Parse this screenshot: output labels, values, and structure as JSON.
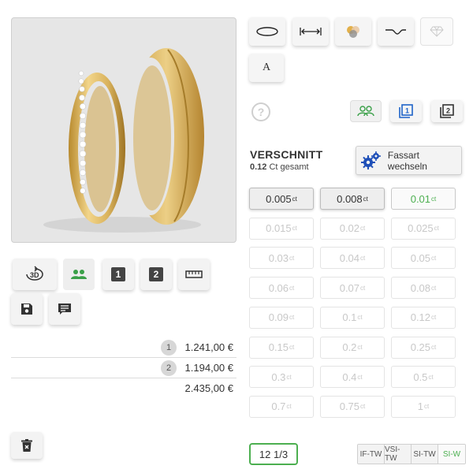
{
  "preview": {
    "image": "wedding-rings-image"
  },
  "toolbar": {
    "buttons": [
      {
        "name": "view-3d-button",
        "label": "3D"
      },
      {
        "name": "pair-view-button",
        "icon": "users-icon"
      },
      {
        "name": "ring-1-button",
        "label": "1"
      },
      {
        "name": "ring-2-button",
        "label": "2"
      },
      {
        "name": "measure-button",
        "icon": "ruler-icon"
      },
      {
        "name": "save-button",
        "icon": "floppy-disk-icon"
      },
      {
        "name": "comment-button",
        "icon": "comment-icon"
      }
    ]
  },
  "prices": [
    {
      "num": "1",
      "value": "1.241,00 €"
    },
    {
      "num": "2",
      "value": "1.194,00 €"
    },
    {
      "num": "",
      "value": "2.435,00 €"
    }
  ],
  "shapes": {
    "letter_label": "A"
  },
  "views": {
    "active": "pair",
    "one": "1",
    "two": "2"
  },
  "section": {
    "title": "VERSCHNITT",
    "total_value": "0.12",
    "total_suffix": "Ct gesamt",
    "fassart_label": "Fassart wechseln"
  },
  "carats": [
    {
      "value": "0.005",
      "state": "enabled"
    },
    {
      "value": "0.008",
      "state": "enabled"
    },
    {
      "value": "0.01",
      "state": "selected"
    },
    {
      "value": "0.015",
      "state": "disabled"
    },
    {
      "value": "0.02",
      "state": "disabled"
    },
    {
      "value": "0.025",
      "state": "disabled"
    },
    {
      "value": "0.03",
      "state": "disabled"
    },
    {
      "value": "0.04",
      "state": "disabled"
    },
    {
      "value": "0.05",
      "state": "disabled"
    },
    {
      "value": "0.06",
      "state": "disabled"
    },
    {
      "value": "0.07",
      "state": "disabled"
    },
    {
      "value": "0.08",
      "state": "disabled"
    },
    {
      "value": "0.09",
      "state": "disabled"
    },
    {
      "value": "0.1",
      "state": "disabled"
    },
    {
      "value": "0.12",
      "state": "disabled"
    },
    {
      "value": "0.15",
      "state": "disabled"
    },
    {
      "value": "0.2",
      "state": "disabled"
    },
    {
      "value": "0.25",
      "state": "disabled"
    },
    {
      "value": "0.3",
      "state": "disabled"
    },
    {
      "value": "0.4",
      "state": "disabled"
    },
    {
      "value": "0.5",
      "state": "disabled"
    },
    {
      "value": "0.7",
      "state": "disabled"
    },
    {
      "value": "0.75",
      "state": "disabled"
    },
    {
      "value": "1",
      "state": "disabled"
    }
  ],
  "carat_unit": "ct",
  "stone_count": "12 1/3",
  "quality": [
    {
      "label": "IF-TW",
      "selected": false
    },
    {
      "label": "VSI-TW",
      "selected": false
    },
    {
      "label": "SI-TW",
      "selected": false
    },
    {
      "label": "SI-W",
      "selected": true
    }
  ],
  "colors": {
    "accent": "#4caf50",
    "selected_blue": "#1e63c8",
    "gold": "#d4ab4f"
  }
}
